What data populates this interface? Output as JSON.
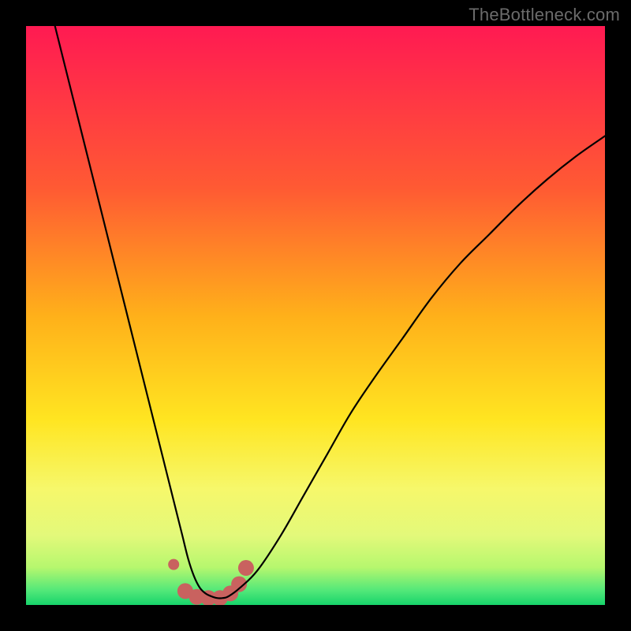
{
  "watermark": "TheBottleneck.com",
  "chart_data": {
    "type": "line",
    "title": "",
    "xlabel": "",
    "ylabel": "",
    "xlim": [
      0,
      100
    ],
    "ylim": [
      0,
      100
    ],
    "grid": false,
    "legend": false,
    "gradient_stops": [
      {
        "offset": 0,
        "color": "#ff1a52"
      },
      {
        "offset": 0.28,
        "color": "#ff5a33"
      },
      {
        "offset": 0.5,
        "color": "#ffb01a"
      },
      {
        "offset": 0.68,
        "color": "#ffe521"
      },
      {
        "offset": 0.8,
        "color": "#f6f86b"
      },
      {
        "offset": 0.88,
        "color": "#e3f97a"
      },
      {
        "offset": 0.935,
        "color": "#b6f76e"
      },
      {
        "offset": 0.975,
        "color": "#52e879"
      },
      {
        "offset": 1.0,
        "color": "#17d46b"
      }
    ],
    "series": [
      {
        "name": "bottleneck-curve",
        "stroke": "#000000",
        "stroke_width": 2.2,
        "x": [
          5,
          7,
          9,
          11,
          13,
          15,
          17,
          19,
          21,
          23,
          24,
          25,
          26,
          27,
          28,
          29,
          30,
          31,
          32,
          33,
          34,
          35,
          37,
          40,
          44,
          48,
          52,
          56,
          60,
          65,
          70,
          75,
          80,
          85,
          90,
          95,
          100
        ],
        "y": [
          100,
          92,
          84,
          76,
          68,
          60,
          52,
          44,
          36,
          28,
          24,
          20,
          16,
          12,
          8,
          5,
          3,
          2,
          1.5,
          1.2,
          1.2,
          1.5,
          3,
          6,
          12,
          19,
          26,
          33,
          39,
          46,
          53,
          59,
          64,
          69,
          73.5,
          77.5,
          81
        ]
      }
    ],
    "marker_group": {
      "name": "optimal-range",
      "color": "#c9625f",
      "points": [
        {
          "x": 25.5,
          "y": 7.0,
          "r": 7
        },
        {
          "x": 27.5,
          "y": 2.4,
          "r": 10
        },
        {
          "x": 29.5,
          "y": 1.4,
          "r": 10
        },
        {
          "x": 31.5,
          "y": 1.2,
          "r": 10
        },
        {
          "x": 33.5,
          "y": 1.2,
          "r": 10
        },
        {
          "x": 35.3,
          "y": 2.0,
          "r": 10
        },
        {
          "x": 36.8,
          "y": 3.6,
          "r": 10
        },
        {
          "x": 38.0,
          "y": 6.4,
          "r": 10
        }
      ]
    }
  }
}
